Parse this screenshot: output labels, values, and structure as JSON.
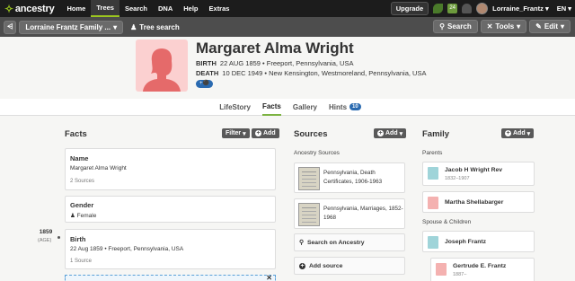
{
  "topnav": {
    "brand": "ancestry",
    "links": [
      "Home",
      "Trees",
      "Search",
      "DNA",
      "Help",
      "Extras"
    ],
    "active_link": "Trees",
    "upgrade": "Upgrade",
    "message_count": "24",
    "user_name": "Lorraine_Frantz",
    "language": "EN"
  },
  "treebar": {
    "tree_name": "Lorraine Frantz Family ...",
    "tree_search": "Tree search",
    "search": "Search",
    "tools": "Tools",
    "edit": "Edit"
  },
  "person": {
    "name": "Margaret Alma Wright",
    "birth_label": "BIRTH",
    "birth_value": "22 AUG 1859 • Freeport, Pennsylvania, USA",
    "death_label": "DEATH",
    "death_value": "10 DEC 1949 • New Kensington, Westmoreland, Pennsylvania, USA"
  },
  "tabs": [
    {
      "label": "LifeStory"
    },
    {
      "label": "Facts"
    },
    {
      "label": "Gallery"
    },
    {
      "label": "Hints",
      "badge": "10"
    }
  ],
  "facts": {
    "title": "Facts",
    "filter": "Filter",
    "add": "Add",
    "name_card": {
      "title": "Name",
      "value": "Margaret Alma Wright",
      "sources": "2 Sources"
    },
    "gender_card": {
      "title": "Gender",
      "value": "Female"
    },
    "birth_card": {
      "year": "1859",
      "age": "(AGE)",
      "title": "Birth",
      "value": "22 Aug 1859 • Freeport, Pennsylvania, USA",
      "sources": "1 Source"
    }
  },
  "sources": {
    "title": "Sources",
    "add": "Add",
    "subhead": "Ancestry Sources",
    "items": [
      {
        "label": "Pennsylvania, Death Certificates, 1906-1963"
      },
      {
        "label": "Pennsylvania, Marriages, 1852-1968"
      }
    ],
    "search_on_ancestry": "Search on Ancestry",
    "add_source": "Add source"
  },
  "family": {
    "title": "Family",
    "add": "Add",
    "parents_label": "Parents",
    "parents": [
      {
        "name": "Jacob H Wright Rev",
        "dates": "1832–1907",
        "gender": "m"
      },
      {
        "name": "Martha Shellabarger",
        "dates": "",
        "gender": "f"
      }
    ],
    "spouse_label": "Spouse & Children",
    "spouse": {
      "name": "Joseph Frantz",
      "dates": "",
      "gender": "m"
    },
    "children": [
      {
        "name": "Gertrude E. Frantz",
        "dates": "1887–",
        "gender": "f"
      }
    ]
  },
  "colors": {
    "nav_bg": "#1c1c1c",
    "accent_green": "#9cc61f",
    "female_pink": "#f4b1b0",
    "male_teal": "#9fd4d9",
    "badge_blue": "#2a6ab0"
  }
}
